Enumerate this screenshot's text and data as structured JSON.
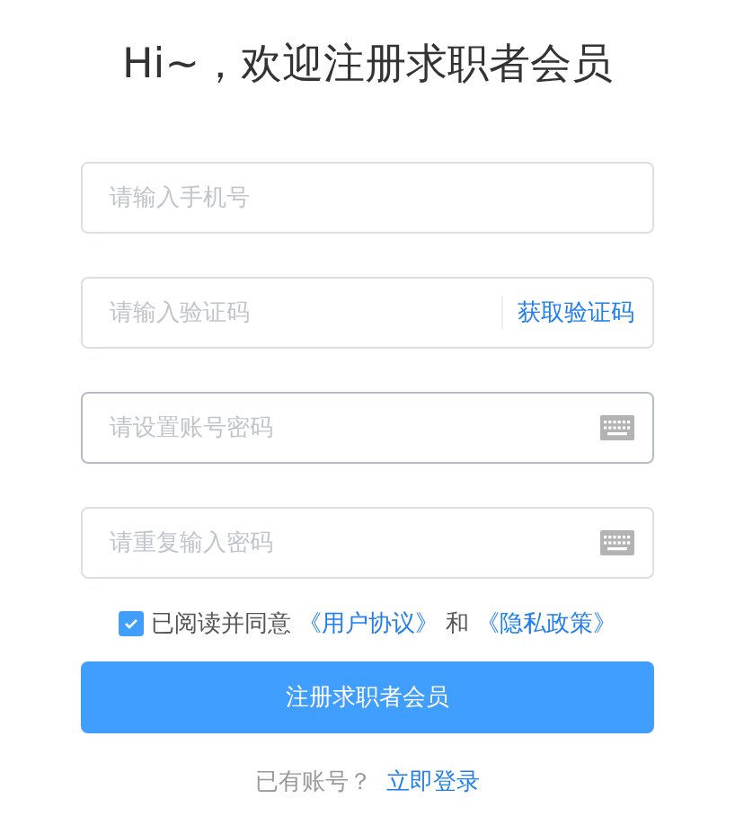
{
  "title": "Hi~，欢迎注册求职者会员",
  "fields": [
    {
      "kind": "text",
      "placeholder": "请输入手机号",
      "focused": false
    },
    {
      "kind": "code",
      "placeholder": "请输入验证码",
      "focused": false,
      "action": "获取验证码"
    },
    {
      "kind": "password",
      "placeholder": "请设置账号密码",
      "focused": true
    },
    {
      "kind": "password",
      "placeholder": "请重复输入密码",
      "focused": false
    }
  ],
  "agreement": {
    "checked": true,
    "prefix": "已阅读并同意",
    "link_1": "《用户协议》",
    "joiner": "和",
    "link_2": "《隐私政策》"
  },
  "submit": "注册求职者会员",
  "login": {
    "prompt": "已有账号？",
    "link": "立即登录"
  }
}
